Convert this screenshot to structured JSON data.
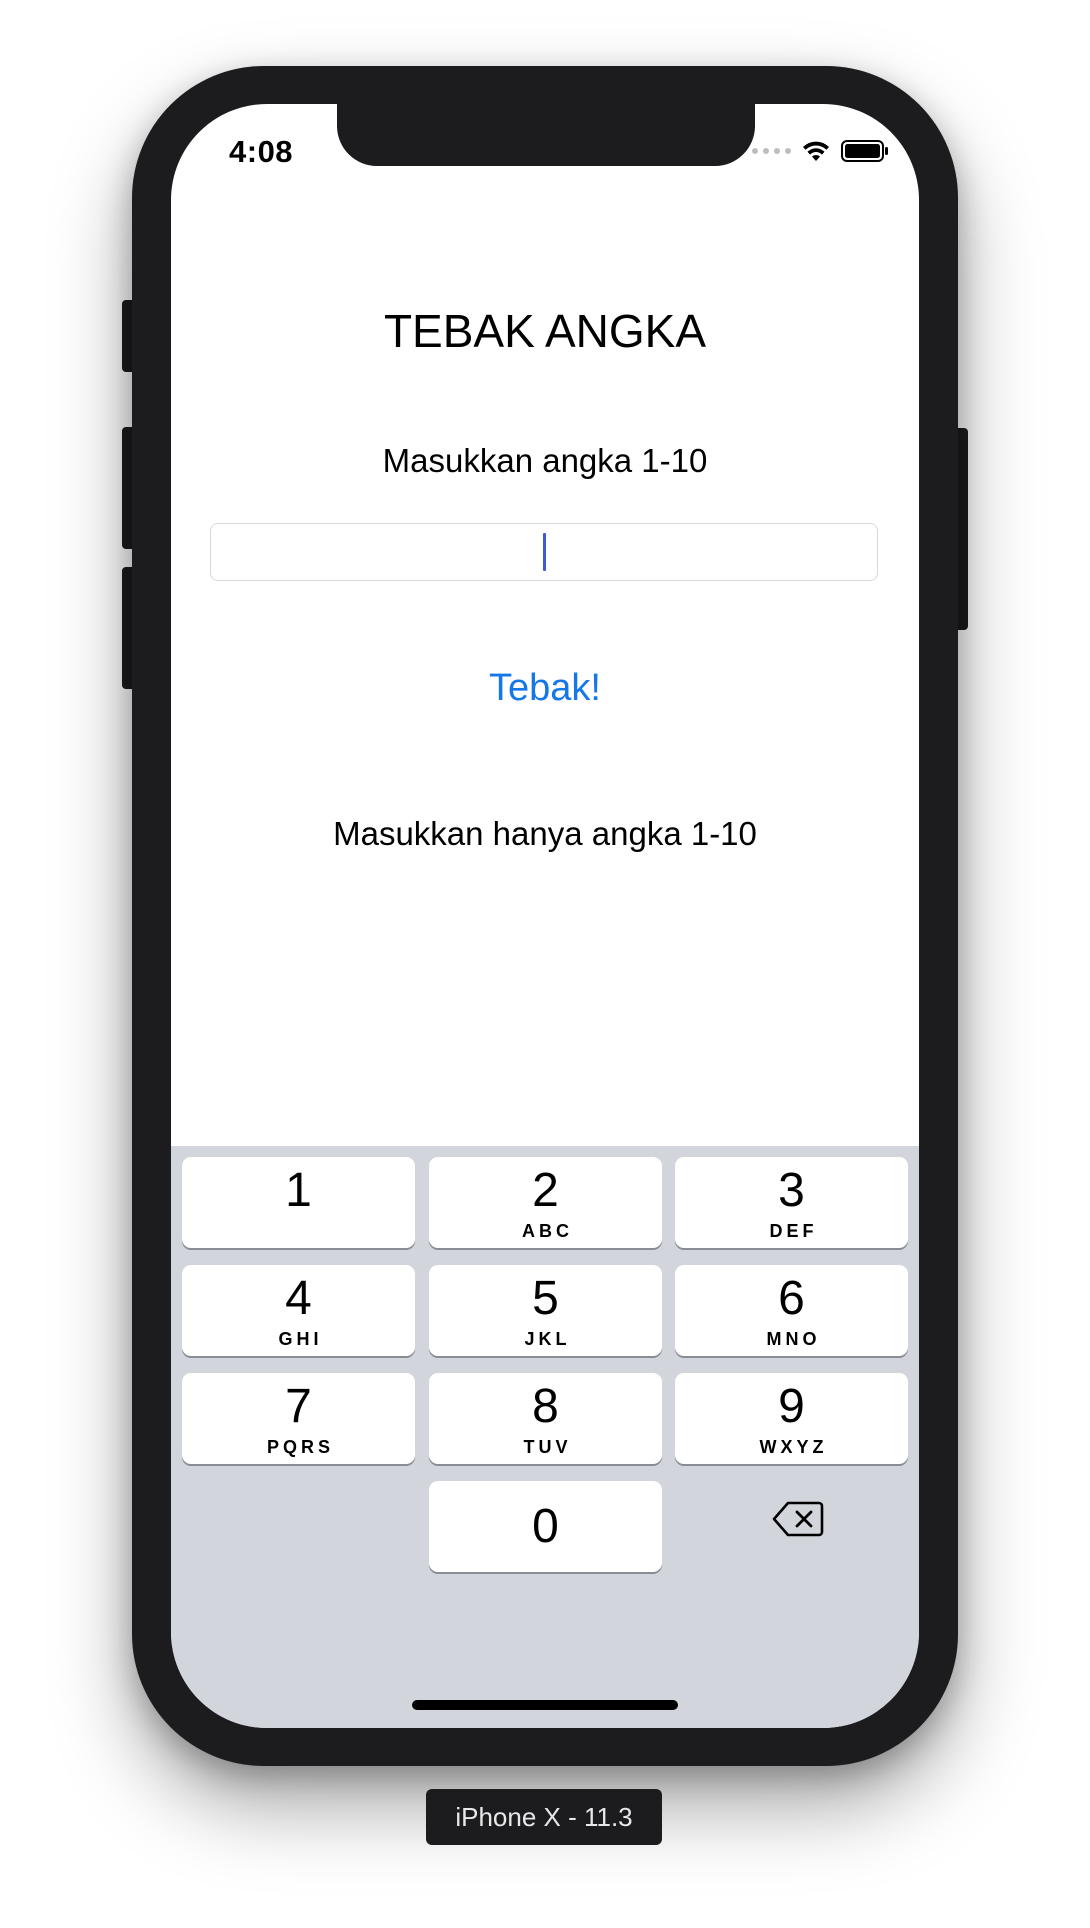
{
  "status_bar": {
    "time": "4:08",
    "icons": [
      "signal-icon",
      "wifi-icon",
      "battery-icon"
    ]
  },
  "app": {
    "title": "TEBAK ANGKA",
    "prompt": "Masukkan angka 1-10",
    "input": {
      "value": "",
      "placeholder": ""
    },
    "guess_button": "Tebak!",
    "result_message": "Masukkan hanya angka 1-10"
  },
  "keyboard": {
    "keys": [
      {
        "digit": "1",
        "letters": ""
      },
      {
        "digit": "2",
        "letters": "ABC"
      },
      {
        "digit": "3",
        "letters": "DEF"
      },
      {
        "digit": "4",
        "letters": "GHI"
      },
      {
        "digit": "5",
        "letters": "JKL"
      },
      {
        "digit": "6",
        "letters": "MNO"
      },
      {
        "digit": "7",
        "letters": "PQRS"
      },
      {
        "digit": "8",
        "letters": "TUV"
      },
      {
        "digit": "9",
        "letters": "WXYZ"
      },
      {
        "digit": "0",
        "letters": ""
      }
    ],
    "delete_icon": "delete-backspace-icon"
  },
  "simulator": {
    "device_label": "iPhone X - 11.3"
  },
  "colors": {
    "accent": "#1677e8",
    "cursor": "#3d5bd9",
    "keyboard_bg": "#d2d5db",
    "bezel": "#1c1c1e"
  }
}
